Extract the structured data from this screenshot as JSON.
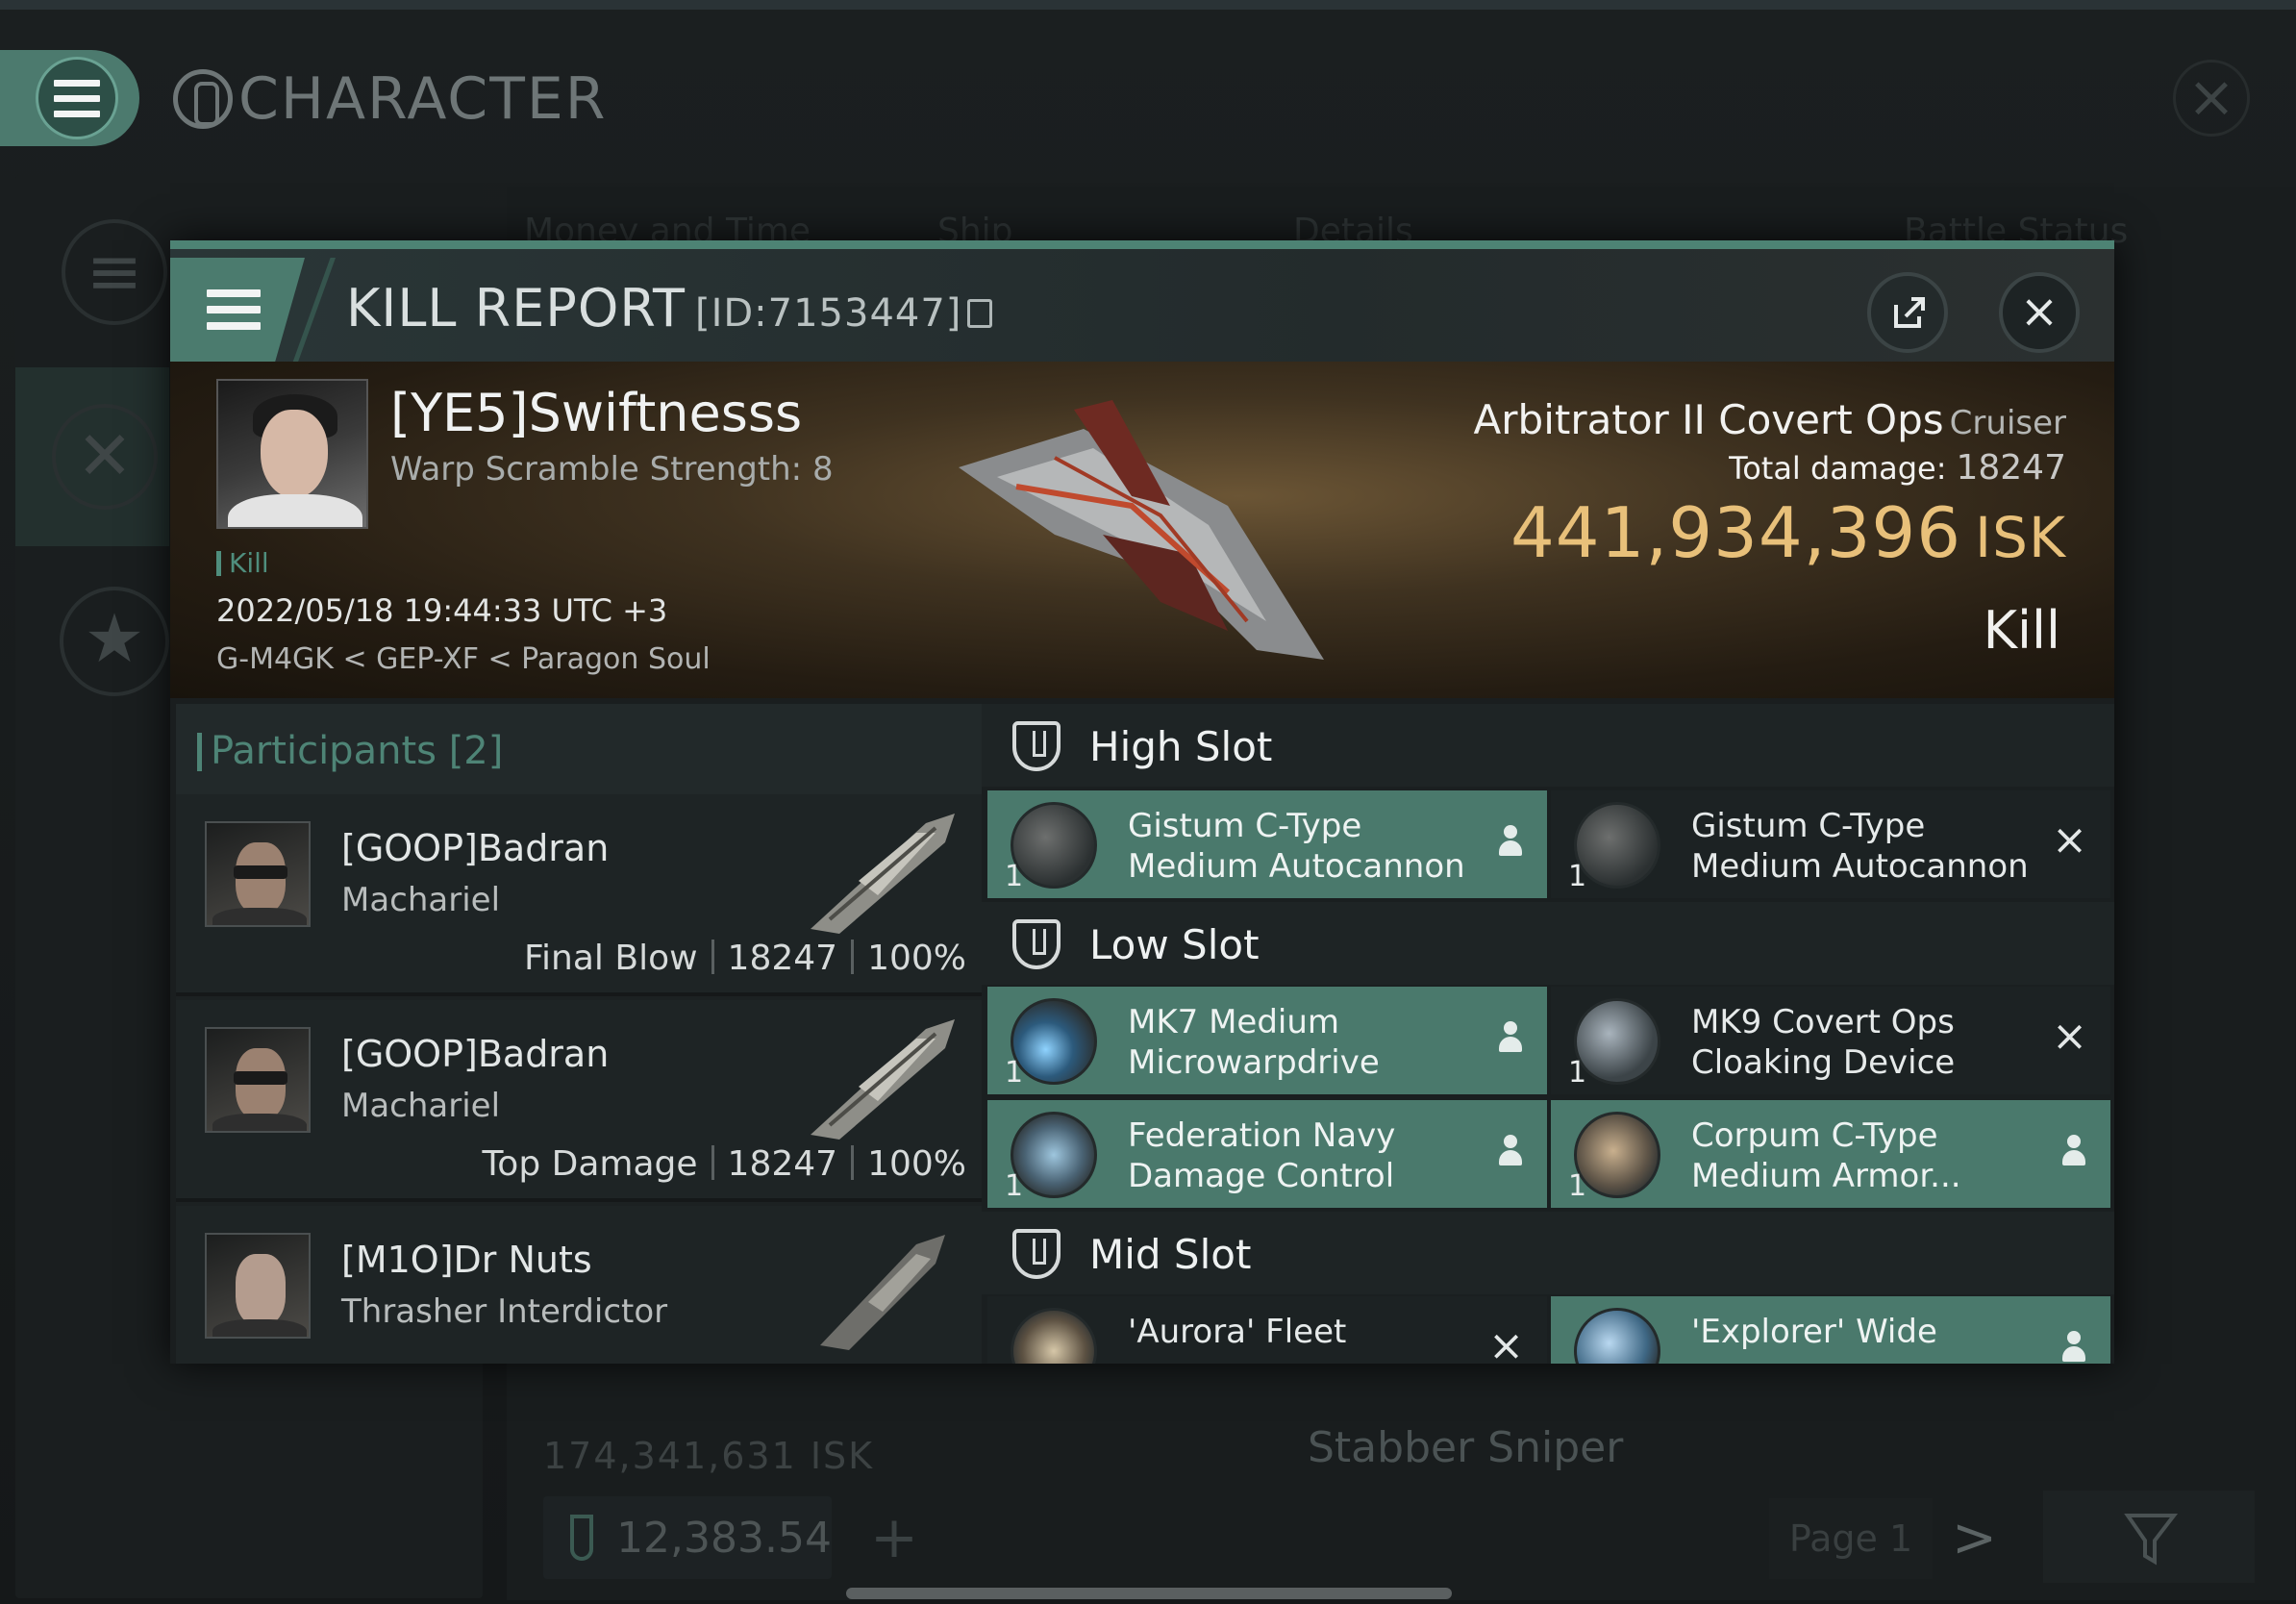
{
  "background": {
    "title": "CHARACTER",
    "columns": [
      "Money and Time",
      "Ship",
      "Details",
      "Battle Status"
    ],
    "bottom_isk": "174,341,631  ISK",
    "bottom_ship": "Stabber Sniper",
    "footer_value": "12,383.54",
    "page_label": "Page 1"
  },
  "kill_report": {
    "title": "KILL REPORT",
    "id": "[ID:7153447]",
    "victim": {
      "name": "[YE5]Swiftnesss",
      "warp_scramble": "Warp Scramble Strength: 8",
      "tag": "Kill",
      "timestamp": "2022/05/18 19:44:33 UTC +3",
      "location": "G-M4GK < GEP-XF < Paragon Soul"
    },
    "ship": {
      "name": "Arbitrator II Covert Ops",
      "class": "Cruiser",
      "total_damage_label": "Total damage:",
      "total_damage": "18247",
      "isk_value": "441,934,396",
      "currency": "ISK",
      "result": "Kill"
    },
    "participants": {
      "title": "Participants",
      "count": "[2]",
      "rows": [
        {
          "name": "[GOOP]Badran",
          "ship": "Machariel",
          "role": "Final Blow",
          "damage": "18247",
          "percent": "100%"
        },
        {
          "name": "[GOOP]Badran",
          "ship": "Machariel",
          "role": "Top Damage",
          "damage": "18247",
          "percent": "100%"
        },
        {
          "name": "[M1O]Dr Nuts",
          "ship": "Thrasher Interdictor",
          "role": "",
          "damage": "",
          "percent": ""
        }
      ]
    },
    "slots": {
      "high": {
        "label": "High Slot",
        "modules": [
          {
            "name": "Gistum C-Type\nMedium Autocannon",
            "qty": "1",
            "state": "dropped"
          },
          {
            "name": "Gistum C-Type\nMedium Autocannon",
            "qty": "1",
            "state": "destroyed"
          }
        ]
      },
      "low": {
        "label": "Low Slot",
        "modules": [
          {
            "name": "MK7 Medium\nMicrowarpdrive",
            "qty": "1",
            "state": "dropped"
          },
          {
            "name": "MK9 Covert Ops\nCloaking Device",
            "qty": "1",
            "state": "destroyed"
          },
          {
            "name": "Federation Navy\nDamage Control",
            "qty": "1",
            "state": "dropped"
          },
          {
            "name": "Corpum C-Type\nMedium Armor...",
            "qty": "1",
            "state": "dropped"
          }
        ]
      },
      "mid": {
        "label": "Mid Slot",
        "modules": [
          {
            "name": "'Aurora' Fleet",
            "qty": "",
            "state": "destroyed"
          },
          {
            "name": "'Explorer' Wide",
            "qty": "",
            "state": "dropped"
          }
        ]
      }
    }
  },
  "colors": {
    "accent": "#4b7b6e",
    "isk_gold": "#e8c07a",
    "fitted_module": "#4a796c"
  }
}
